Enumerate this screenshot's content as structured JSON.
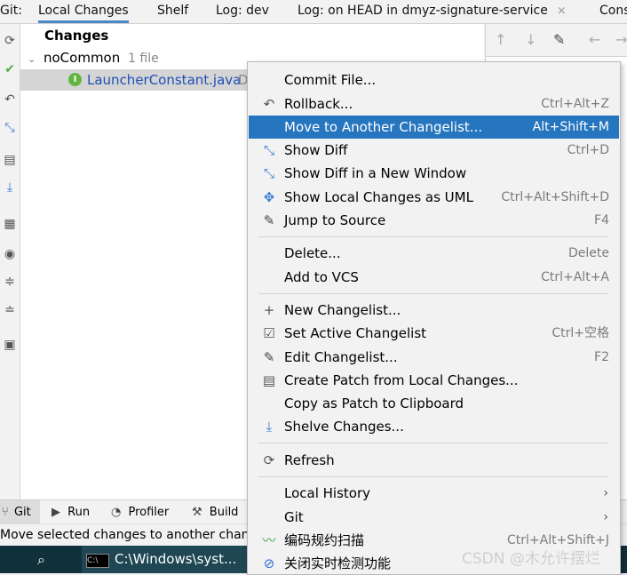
{
  "tabbar": {
    "git_label": "Git:",
    "tabs": [
      {
        "label": "Local Changes"
      },
      {
        "label": "Shelf"
      },
      {
        "label": "Log: dev"
      },
      {
        "label": "Log: on HEAD in dmyz-signature-service"
      },
      {
        "label": "Cons"
      }
    ],
    "close_glyph": "×"
  },
  "tree": {
    "changes_label": "Changes",
    "changelist_name": "noCommon",
    "changelist_count": "1 file",
    "file_name": "LauncherConstant.java",
    "file_suffix": "D",
    "file_badge": "I"
  },
  "menu": {
    "items": [
      {
        "label": "Commit File...",
        "shortcut": "",
        "icon": ""
      },
      {
        "label": "Rollback...",
        "shortcut": "Ctrl+Alt+Z",
        "icon": "rollback-icon"
      },
      {
        "label": "Move to Another Changelist...",
        "shortcut": "Alt+Shift+M",
        "icon": ""
      },
      {
        "label": "Show Diff",
        "shortcut": "Ctrl+D",
        "icon": "diff-icon"
      },
      {
        "label": "Show Diff in a New Window",
        "shortcut": "",
        "icon": "diff-icon"
      },
      {
        "label": "Show Local Changes as UML",
        "shortcut": "Ctrl+Alt+Shift+D",
        "icon": "uml-icon"
      },
      {
        "label": "Jump to Source",
        "shortcut": "F4",
        "icon": "edit-icon"
      },
      {
        "label": "Delete...",
        "shortcut": "Delete",
        "icon": ""
      },
      {
        "label": "Add to VCS",
        "shortcut": "Ctrl+Alt+A",
        "icon": ""
      },
      {
        "label": "New Changelist...",
        "shortcut": "",
        "icon": "plus-icon"
      },
      {
        "label": "Set Active Changelist",
        "shortcut": "Ctrl+空格",
        "icon": "checkbox-icon"
      },
      {
        "label": "Edit Changelist...",
        "shortcut": "F2",
        "icon": "pencil-icon"
      },
      {
        "label": "Create Patch from Local Changes...",
        "shortcut": "",
        "icon": "patch-icon"
      },
      {
        "label": "Copy as Patch to Clipboard",
        "shortcut": "",
        "icon": ""
      },
      {
        "label": "Shelve Changes...",
        "shortcut": "",
        "icon": "shelve-icon"
      },
      {
        "label": "Refresh",
        "shortcut": "",
        "icon": "refresh-icon"
      },
      {
        "label": "Local History",
        "shortcut": "",
        "icon": ""
      },
      {
        "label": "Git",
        "shortcut": "",
        "icon": ""
      },
      {
        "label": "编码规约扫描",
        "shortcut": "Ctrl+Alt+Shift+J",
        "icon": "scan-icon"
      },
      {
        "label": "关闭实时检测功能",
        "shortcut": "",
        "icon": "stop-icon"
      }
    ]
  },
  "bottombar": {
    "tabs": [
      {
        "label": "Git"
      },
      {
        "label": "Run"
      },
      {
        "label": "Profiler"
      },
      {
        "label": "Build"
      }
    ]
  },
  "status": {
    "message": "Move selected changes to another changelist"
  },
  "taskbar": {
    "window_title": "C:\\Windows\\syst..."
  },
  "watermark": "CSDN @木允许摆烂",
  "colors": {
    "highlight": "#2675bf",
    "accent_blue": "#4a88c7",
    "file_text": "#1f4fb5"
  }
}
